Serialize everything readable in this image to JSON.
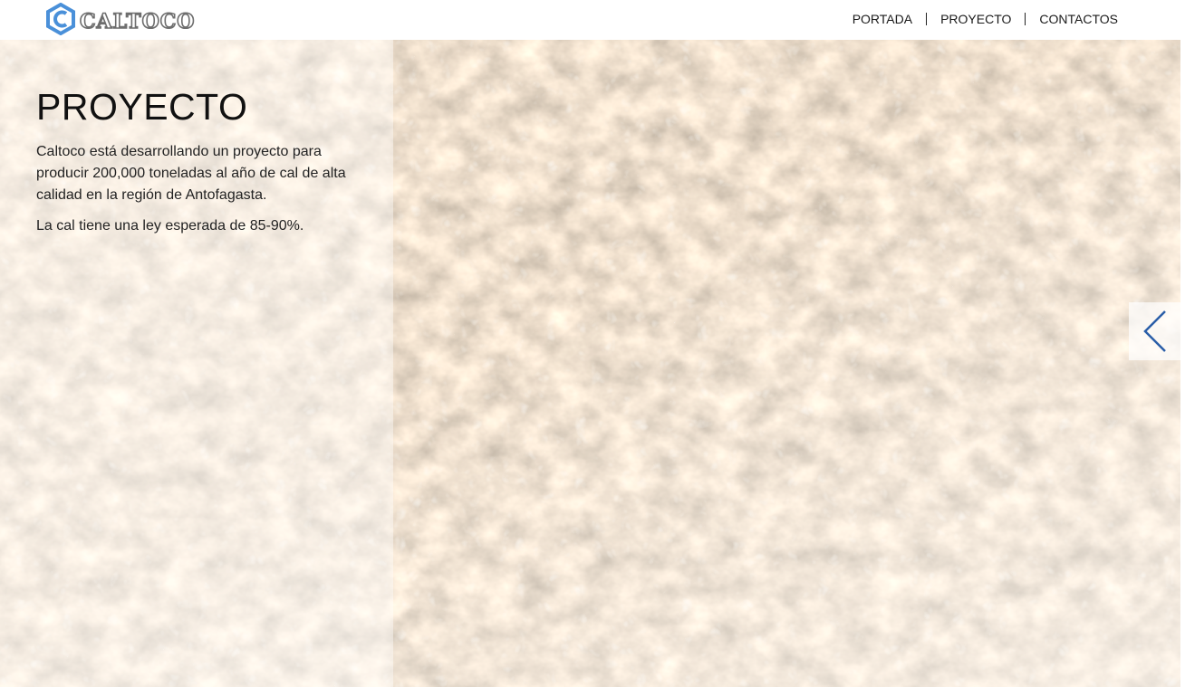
{
  "brand": {
    "name": "CALTOCO",
    "logo_icon": "hexagon-c-logo-icon",
    "logo_color": "#4a90d9"
  },
  "nav": {
    "items": [
      {
        "label": "PORTADA"
      },
      {
        "label": "PROYECTO"
      },
      {
        "label": "CONTACTOS"
      }
    ]
  },
  "hero": {
    "title": "PROYECTO",
    "paragraphs": [
      "Caltoco está desarrollando un proyecto para producir 200,000 toneladas al año de cal de alta calidad en la región de Antofagasta.",
      "La cal tiene una ley esperada de 85-90%."
    ],
    "background": "shell-rubble-photo",
    "slider_prev_icon": "chevron-left-icon",
    "accent": "#2a5ea8"
  }
}
